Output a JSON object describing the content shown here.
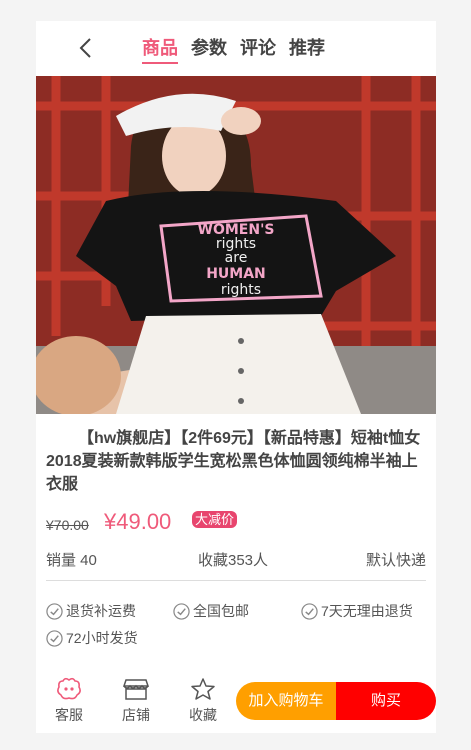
{
  "header": {
    "tabs": [
      {
        "label": "商品",
        "active": true
      },
      {
        "label": "参数",
        "active": false
      },
      {
        "label": "评论",
        "active": false
      },
      {
        "label": "推荐",
        "active": false
      }
    ]
  },
  "product": {
    "title": "【hw旗舰店】【2件69元】【新品特惠】短袖t恤女2018夏装新款韩版学生宽松黑色体恤圆领纯棉半袖上衣服",
    "old_price": "¥70.00",
    "price": "¥49.00",
    "badge": "大减价",
    "shirt_print": [
      "WOMEN'S",
      "rights",
      "are",
      "HUMAN",
      "rights"
    ]
  },
  "stats": {
    "sales": "销量 40",
    "favorites": "收藏353人",
    "shipping": "默认快递"
  },
  "services": [
    "退货补运费",
    "全国包邮",
    "7天无理由退货",
    "72小时发货"
  ],
  "bottom_bar": {
    "service_label": "客服",
    "shop_label": "店铺",
    "favorite_label": "收藏",
    "cart_label": "加入购物车",
    "buy_label": "购买"
  },
  "colors": {
    "accent": "#ef5a7a",
    "cart": "#ff9f00",
    "buy": "#ff0000"
  }
}
